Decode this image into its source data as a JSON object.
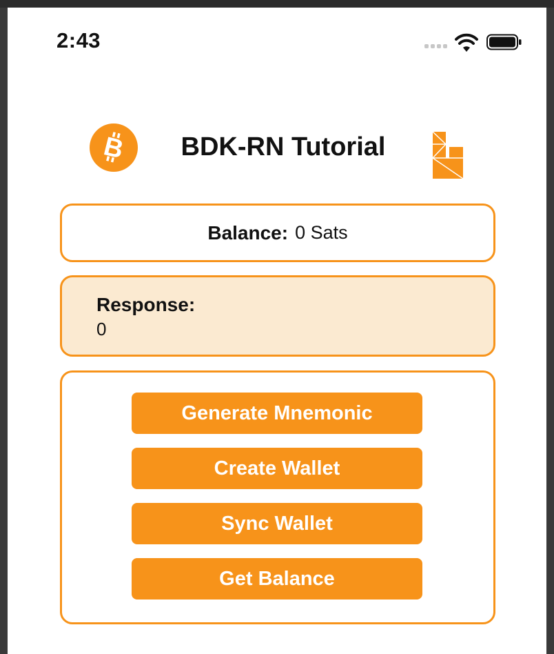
{
  "status_bar": {
    "time": "2:43"
  },
  "header": {
    "title": "BDK-RN Tutorial",
    "left_icon": "bitcoin-icon",
    "right_icon": "bdk-logo-icon"
  },
  "balance": {
    "label": "Balance:",
    "value": "0 Sats"
  },
  "response": {
    "label": "Response:",
    "value": "0"
  },
  "actions": [
    {
      "label": "Generate Mnemonic"
    },
    {
      "label": "Create Wallet"
    },
    {
      "label": "Sync Wallet"
    },
    {
      "label": "Get Balance"
    }
  ],
  "colors": {
    "accent": "#f7931a",
    "response_bg": "#fbead1",
    "text": "#111111"
  }
}
